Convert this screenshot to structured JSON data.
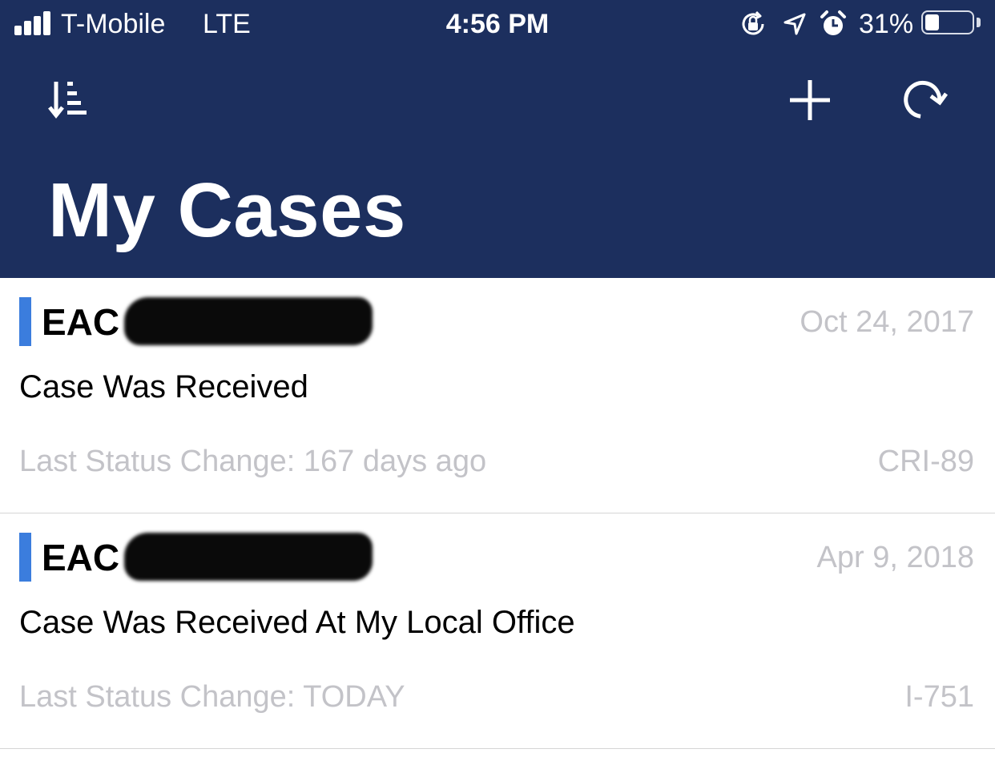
{
  "status_bar": {
    "carrier": "T-Mobile",
    "network": "LTE",
    "time": "4:56 PM",
    "battery_percent_label": "31%",
    "battery_level": 0.31,
    "signal_bars": 4,
    "icons": [
      "orientation-lock-icon",
      "location-arrow-icon",
      "alarm-icon"
    ]
  },
  "header": {
    "title": "My Cases",
    "background_color": "#1c2f5e",
    "left_action_icon": "sort-icon",
    "right_action_icons": [
      "add-icon",
      "refresh-icon"
    ]
  },
  "cases": [
    {
      "number_prefix": "EAC",
      "number_redacted": true,
      "date": "Oct 24, 2017",
      "status": "Case Was Received",
      "last_status_change": "Last Status Change: 167 days ago",
      "form": "CRI-89",
      "accent_color": "#3b7ddd"
    },
    {
      "number_prefix": "EAC",
      "number_redacted": true,
      "date": "Apr 9, 2018",
      "status": "Case Was Received At My Local Office",
      "last_status_change": "Last Status Change: TODAY",
      "form": "I-751",
      "accent_color": "#3b7ddd"
    }
  ]
}
